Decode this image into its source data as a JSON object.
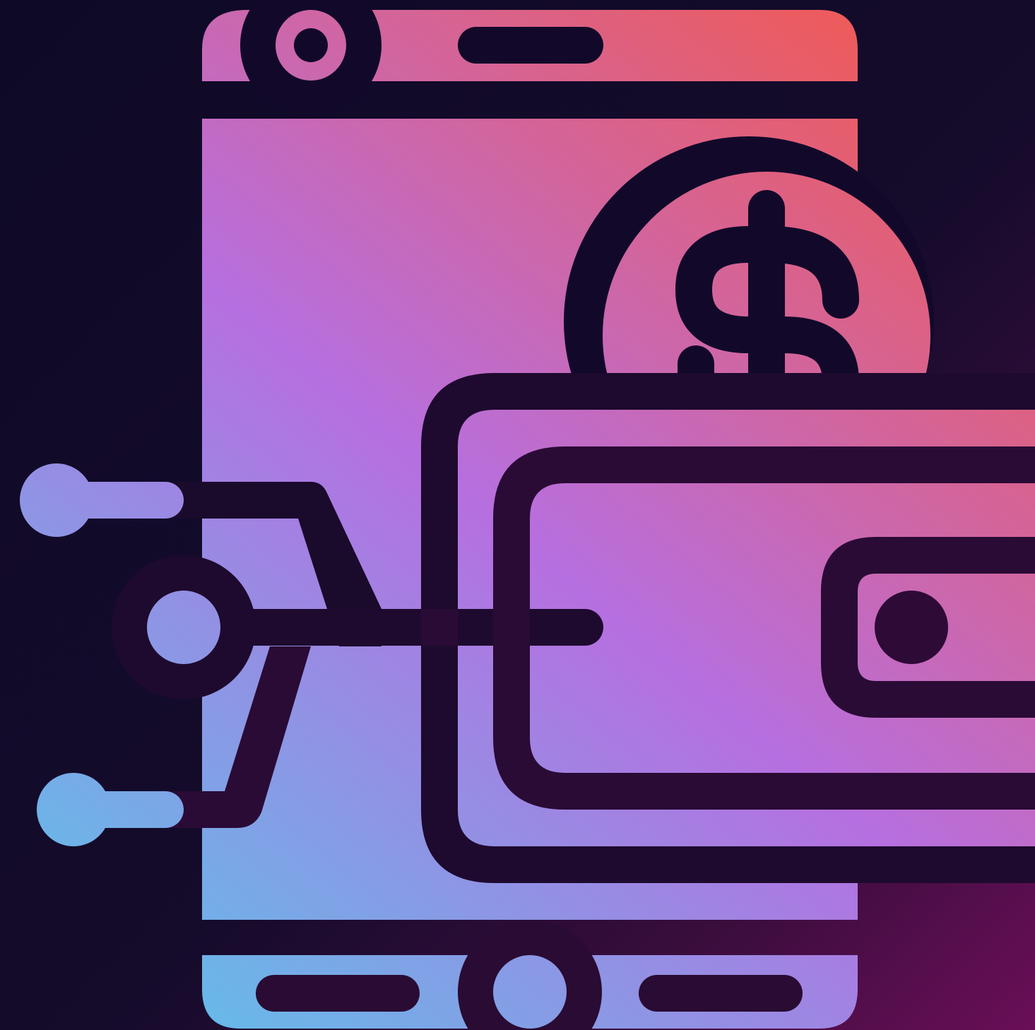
{
  "illustration": {
    "icon": "digital-wallet-icon",
    "parts": [
      "smartphone-icon",
      "dollar-coin-icon",
      "wallet-icon",
      "circuit-lines-icon"
    ]
  },
  "colors": {
    "background_top": "#0e0a26",
    "background_bottom": "#6a0e58",
    "gradient_pink_red": "#f05a55",
    "gradient_purple": "#b66fe0",
    "gradient_blue": "#5ec2ea",
    "outline": "#12092a"
  }
}
